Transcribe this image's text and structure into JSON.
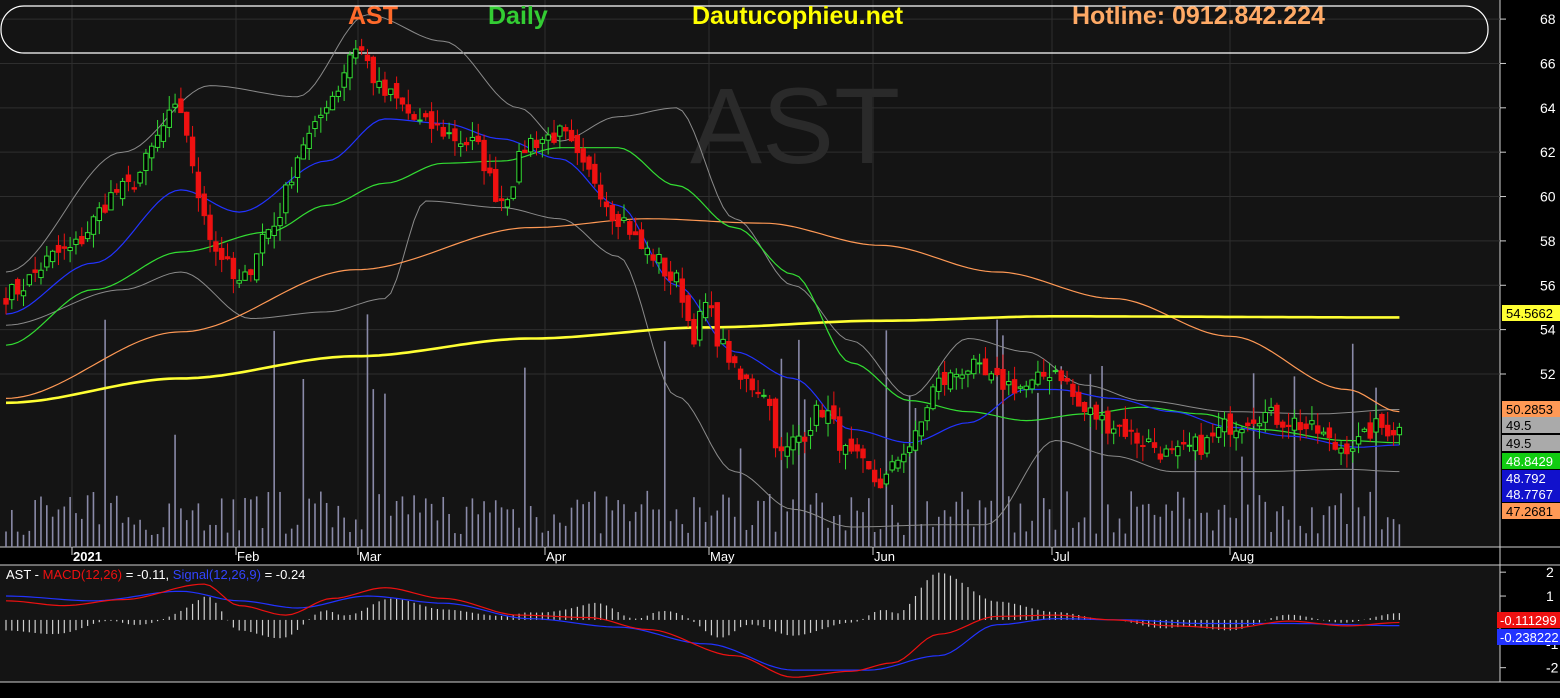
{
  "header": {
    "symbol": "AST",
    "period": "Daily",
    "site": "Dautucophieu.net",
    "hotline": "Hotline: 0912.842.224",
    "watermark": "AST"
  },
  "colors": {
    "background": "#000000",
    "up_candle": "#33dd33",
    "down_candle": "#ee1111",
    "sma_yellow": "#ffff33",
    "sma_orange": "#ff9955",
    "ma_green": "#33dd33",
    "ma_blue": "#2233ff",
    "bollinger": "#8a8a8a",
    "volume": "#8a8aa8"
  },
  "chart_data": [
    {
      "type": "candlestick",
      "title": "AST Daily",
      "x_tick_labels": [
        "2021",
        "Feb",
        "Mar",
        "Apr",
        "May",
        "Jun",
        "Jul",
        "Aug"
      ],
      "y_ticks": [
        52,
        54,
        56,
        58,
        60,
        62,
        64,
        66,
        68
      ],
      "ylim": [
        44.2,
        68.5
      ],
      "grid": true,
      "price_labels": [
        {
          "text": "54.5662",
          "color": "#ffff33"
        },
        {
          "text": "50.2853",
          "color": "#ff9955"
        },
        {
          "text": "49.5",
          "color": "#aaaaaa"
        },
        {
          "text": "49.5",
          "color": "#aaaaaa"
        },
        {
          "text": "48.8429",
          "color": "#11cc11"
        },
        {
          "text": "48.792",
          "color": "#1111cc"
        },
        {
          "text": "48.7767",
          "color": "#1111cc"
        },
        {
          "text": "47.2681",
          "color": "#ff9955"
        }
      ],
      "sma_yellow_anchors": [
        [
          0,
          50.7
        ],
        [
          30,
          51.8
        ],
        [
          60,
          52.8
        ],
        [
          90,
          53.6
        ],
        [
          120,
          54.1
        ],
        [
          150,
          54.4
        ],
        [
          180,
          54.6
        ],
        [
          239,
          54.55
        ]
      ],
      "sma_orange_anchors": [
        [
          0,
          50.9
        ],
        [
          30,
          53.9
        ],
        [
          60,
          56.7
        ],
        [
          90,
          58.6
        ],
        [
          110,
          59.0
        ],
        [
          130,
          58.8
        ],
        [
          150,
          57.8
        ],
        [
          170,
          56.6
        ],
        [
          190,
          55.4
        ],
        [
          210,
          53.7
        ],
        [
          230,
          51.3
        ],
        [
          239,
          50.3
        ]
      ],
      "close_anchors": [
        [
          0,
          55.6
        ],
        [
          10,
          57.5
        ],
        [
          20,
          60.3
        ],
        [
          30,
          63.9
        ],
        [
          33,
          60.1
        ],
        [
          36,
          57.6
        ],
        [
          40,
          56.0
        ],
        [
          45,
          58.5
        ],
        [
          52,
          62.7
        ],
        [
          56,
          64.6
        ],
        [
          60,
          66.8
        ],
        [
          65,
          64.6
        ],
        [
          72,
          63.2
        ],
        [
          80,
          62.4
        ],
        [
          85,
          59.9
        ],
        [
          90,
          62.5
        ],
        [
          95,
          62.8
        ],
        [
          100,
          61.0
        ],
        [
          105,
          59.1
        ],
        [
          110,
          57.5
        ],
        [
          115,
          56.2
        ],
        [
          118,
          53.8
        ],
        [
          120,
          55.1
        ],
        [
          123,
          53.2
        ],
        [
          126,
          51.7
        ],
        [
          130,
          51.3
        ],
        [
          133,
          48.3
        ],
        [
          136,
          49.2
        ],
        [
          140,
          50.4
        ],
        [
          145,
          48.2
        ],
        [
          150,
          47.1
        ],
        [
          155,
          48.8
        ],
        [
          160,
          51.6
        ],
        [
          165,
          52.3
        ],
        [
          170,
          51.6
        ],
        [
          175,
          51.4
        ],
        [
          180,
          52.2
        ],
        [
          185,
          50.3
        ],
        [
          190,
          49.7
        ],
        [
          195,
          49.0
        ],
        [
          200,
          48.3
        ],
        [
          205,
          48.8
        ],
        [
          210,
          49.7
        ],
        [
          215,
          50.2
        ],
        [
          220,
          49.9
        ],
        [
          225,
          49.4
        ],
        [
          228,
          48.7
        ],
        [
          232,
          48.9
        ],
        [
          235,
          49.6
        ],
        [
          239,
          49.5
        ]
      ],
      "upper_band_anchors": [
        [
          0,
          56.6
        ],
        [
          20,
          62.0
        ],
        [
          35,
          65.0
        ],
        [
          50,
          64.5
        ],
        [
          62,
          68.2
        ],
        [
          75,
          67.0
        ],
        [
          88,
          64.0
        ],
        [
          95,
          62.5
        ],
        [
          105,
          63.6
        ],
        [
          115,
          64.0
        ],
        [
          125,
          59.0
        ],
        [
          135,
          56.0
        ],
        [
          145,
          53.5
        ],
        [
          155,
          51.0
        ],
        [
          165,
          53.6
        ],
        [
          175,
          53.0
        ],
        [
          185,
          51.5
        ],
        [
          195,
          50.8
        ],
        [
          210,
          50.3
        ],
        [
          225,
          50.2
        ],
        [
          239,
          50.4
        ]
      ],
      "lower_band_anchors": [
        [
          0,
          54.2
        ],
        [
          20,
          55.8
        ],
        [
          30,
          56.6
        ],
        [
          42,
          54.5
        ],
        [
          55,
          54.8
        ],
        [
          65,
          55.4
        ],
        [
          72,
          59.8
        ],
        [
          85,
          59.5
        ],
        [
          95,
          59.0
        ],
        [
          105,
          57.3
        ],
        [
          115,
          51.0
        ],
        [
          125,
          47.6
        ],
        [
          135,
          45.9
        ],
        [
          145,
          45.1
        ],
        [
          160,
          45.2
        ],
        [
          168,
          45.2
        ],
        [
          180,
          49.0
        ],
        [
          190,
          48.3
        ],
        [
          200,
          47.6
        ],
        [
          215,
          47.6
        ],
        [
          230,
          47.7
        ],
        [
          239,
          47.6
        ]
      ],
      "ma_green_anchors": [
        [
          0,
          53.3
        ],
        [
          15,
          55.8
        ],
        [
          30,
          57.5
        ],
        [
          45,
          58.4
        ],
        [
          55,
          59.6
        ],
        [
          65,
          60.6
        ],
        [
          75,
          61.5
        ],
        [
          85,
          61.6
        ],
        [
          95,
          62.2
        ],
        [
          105,
          62.2
        ],
        [
          115,
          60.5
        ],
        [
          125,
          58.6
        ],
        [
          135,
          56.5
        ],
        [
          145,
          52.5
        ],
        [
          155,
          50.8
        ],
        [
          165,
          50.3
        ],
        [
          175,
          49.9
        ],
        [
          185,
          50.2
        ],
        [
          195,
          50.5
        ],
        [
          205,
          50.2
        ],
        [
          215,
          49.5
        ],
        [
          230,
          49.0
        ],
        [
          239,
          48.9
        ]
      ],
      "ma_blue_anchors": [
        [
          0,
          54.7
        ],
        [
          15,
          57.0
        ],
        [
          30,
          60.3
        ],
        [
          40,
          59.3
        ],
        [
          55,
          61.6
        ],
        [
          65,
          63.5
        ],
        [
          75,
          63.3
        ],
        [
          85,
          62.6
        ],
        [
          95,
          61.7
        ],
        [
          105,
          59.6
        ],
        [
          115,
          56.0
        ],
        [
          125,
          53.0
        ],
        [
          135,
          51.8
        ],
        [
          145,
          49.5
        ],
        [
          155,
          48.9
        ],
        [
          165,
          49.8
        ],
        [
          175,
          51.3
        ],
        [
          180,
          51.3
        ],
        [
          190,
          50.9
        ],
        [
          200,
          50.3
        ],
        [
          210,
          49.6
        ],
        [
          220,
          49.2
        ],
        [
          232,
          48.7
        ],
        [
          239,
          48.8
        ]
      ]
    },
    {
      "type": "macd",
      "legend_prefix": "AST - ",
      "macd_label": "MACD(12,26)",
      "macd_value": " = -0.11, ",
      "signal_label": "Signal(12,26,9)",
      "signal_value": " = -0.24",
      "y_ticks": [
        "2",
        "1",
        "-1",
        "-2"
      ],
      "ylim": [
        -2.6,
        2.3
      ],
      "value_labels": [
        {
          "text": "-0.111299",
          "color": "#ee1111"
        },
        {
          "text": "-0.238222",
          "color": "#2233ff"
        }
      ],
      "macd_anchors": [
        [
          0,
          0.8
        ],
        [
          10,
          0.6
        ],
        [
          20,
          0.85
        ],
        [
          34,
          1.5
        ],
        [
          40,
          0.6
        ],
        [
          48,
          0.2
        ],
        [
          56,
          0.9
        ],
        [
          65,
          1.35
        ],
        [
          75,
          0.9
        ],
        [
          88,
          0.2
        ],
        [
          100,
          0.1
        ],
        [
          110,
          -0.4
        ],
        [
          125,
          -1.5
        ],
        [
          135,
          -2.4
        ],
        [
          145,
          -2.15
        ],
        [
          152,
          -1.8
        ],
        [
          160,
          -0.6
        ],
        [
          170,
          0.15
        ],
        [
          180,
          0.2
        ],
        [
          190,
          0.0
        ],
        [
          200,
          -0.25
        ],
        [
          210,
          -0.35
        ],
        [
          220,
          -0.05
        ],
        [
          230,
          -0.25
        ],
        [
          239,
          -0.11
        ]
      ],
      "signal_anchors": [
        [
          0,
          1.0
        ],
        [
          15,
          0.8
        ],
        [
          30,
          1.2
        ],
        [
          40,
          0.8
        ],
        [
          50,
          0.5
        ],
        [
          62,
          1.0
        ],
        [
          75,
          0.7
        ],
        [
          90,
          0.05
        ],
        [
          105,
          -0.3
        ],
        [
          120,
          -1.0
        ],
        [
          135,
          -2.1
        ],
        [
          148,
          -2.1
        ],
        [
          160,
          -1.5
        ],
        [
          170,
          -0.2
        ],
        [
          180,
          0.05
        ],
        [
          192,
          0.0
        ],
        [
          205,
          -0.15
        ],
        [
          220,
          -0.15
        ],
        [
          239,
          -0.24
        ]
      ]
    }
  ]
}
